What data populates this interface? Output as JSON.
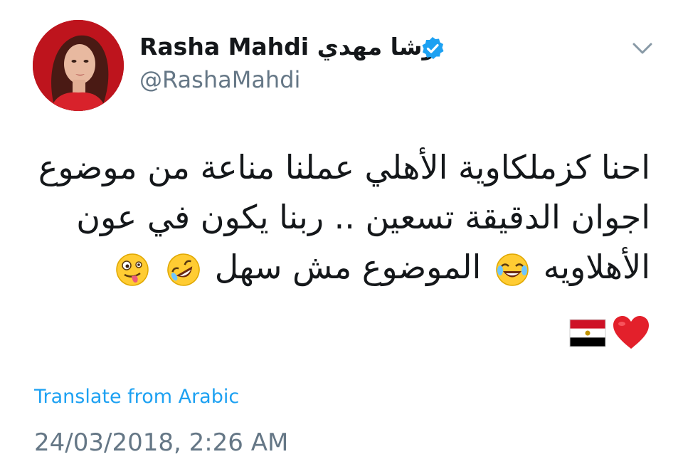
{
  "author": {
    "display_name": "Rasha Mahdi رشا مهدي",
    "handle": "@RashaMahdi",
    "verified": true,
    "avatar_icon": "profile-photo"
  },
  "tweet": {
    "lines": [
      "احنا كزملكاوية الأهلي عملنا مناعة من موضوع",
      "اجوان الدقيقة تسعين .. ربنا يكون في عون",
      "الأهلاويه"
    ],
    "line3_mid": "الموضوع مش سهل",
    "emojis": [
      "joy-emoji",
      "rofl-emoji",
      "winking-tongue-emoji",
      "red-heart-emoji",
      "egypt-flag-emoji"
    ]
  },
  "translate_label": "Translate from Arabic",
  "timestamp": "24/03/2018, 2:26 AM",
  "colors": {
    "link": "#1da1f2",
    "secondary_text": "#657786",
    "primary_text": "#14171a",
    "verified": "#1da1f2"
  }
}
